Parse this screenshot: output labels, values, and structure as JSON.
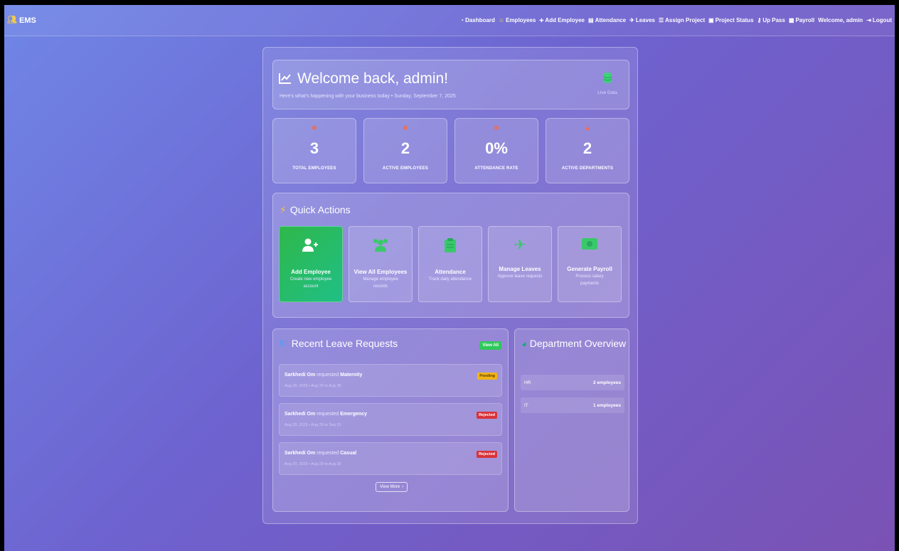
{
  "nav": {
    "brand": "EMS",
    "items": [
      {
        "label": "Dashboard",
        "icon": "gauge-icon"
      },
      {
        "label": "Employees",
        "icon": "users-icon"
      },
      {
        "label": "Add Employee",
        "icon": "user-plus-icon"
      },
      {
        "label": "Attendance",
        "icon": "clipboard-icon"
      },
      {
        "label": "Leaves",
        "icon": "plane-icon"
      },
      {
        "label": "Assign Project",
        "icon": "list-icon"
      },
      {
        "label": "Project Status",
        "icon": "clipboard-check-icon"
      },
      {
        "label": "Up Pass",
        "icon": "key-icon"
      },
      {
        "label": "Payroll",
        "icon": "money-icon"
      }
    ],
    "welcome": "Welcome, admin",
    "logout": "Logout"
  },
  "welcome": {
    "title": "Welcome back, admin!",
    "subtitle": "Here's what's happening with your business today • Sunday, September 7, 2025",
    "live_label": "Live Data"
  },
  "stats": [
    {
      "value": "3",
      "label": "TOTAL EMPLOYEES",
      "icon": "users-icon"
    },
    {
      "value": "2",
      "label": "ACTIVE EMPLOYEES",
      "icon": "user-check-icon"
    },
    {
      "value": "0%",
      "label": "ATTENDANCE RATE",
      "icon": "calendar-icon"
    },
    {
      "value": "2",
      "label": "ACTIVE DEPARTMENTS",
      "icon": "building-icon"
    }
  ],
  "quick_actions": {
    "title": "Quick Actions",
    "items": [
      {
        "title": "Add Employee",
        "desc": "Create new employee account",
        "icon": "user-plus-icon"
      },
      {
        "title": "View All Employees",
        "desc": "Manage employee records",
        "icon": "users-icon"
      },
      {
        "title": "Attendance",
        "desc": "Track daily attendance",
        "icon": "clipboard-icon"
      },
      {
        "title": "Manage Leaves",
        "desc": "Approve leave requests",
        "icon": "plane-icon"
      },
      {
        "title": "Generate Payroll",
        "desc": "Process salary payments",
        "icon": "money-icon"
      }
    ]
  },
  "leave": {
    "title": "Recent Leave Requests",
    "view_all": "View All",
    "requested_word": "requested",
    "requests": [
      {
        "name": "Sarkhedi Om",
        "type": "Maternity",
        "dates": "Aug 29, 2025 • Aug 28 to Aug 28",
        "status": "Pending"
      },
      {
        "name": "Sarkhedi Om",
        "type": "Emergency",
        "dates": "Aug 29, 2025 • Aug 29 to Sep 01",
        "status": "Rejected"
      },
      {
        "name": "Sarkhedi Om",
        "type": "Casual",
        "dates": "Aug 29, 2025 • Aug 29 to Aug 30",
        "status": "Rejected"
      }
    ],
    "view_more": "View More"
  },
  "departments": {
    "title": "Department Overview",
    "rows": [
      {
        "name": "HR",
        "count": "2 employees"
      },
      {
        "name": "IT",
        "count": "1 employees"
      }
    ]
  },
  "colors": {
    "accent_green": "#2ec95a",
    "pending": "#f1b418",
    "rejected": "#d8333a",
    "stat_icon": "#e8705e"
  }
}
